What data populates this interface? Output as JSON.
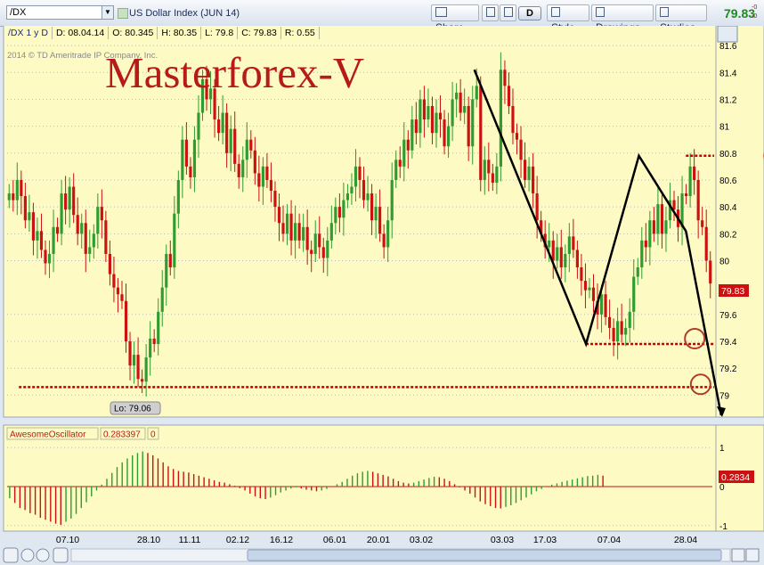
{
  "toolbar": {
    "symbol": "/DX",
    "instrument_name": "US Dollar Index (JUN 14)",
    "buttons": {
      "share": "Share",
      "d": "D",
      "style": "Style",
      "drawings": "Drawings",
      "studies": "Studies"
    },
    "last_price": "79.83",
    "change_top": "-0",
    "change_bottom": "-0"
  },
  "info_bar": {
    "symbol_period": "/DX 1 y D",
    "date": "D: 08.04.14",
    "open": "O: 80.345",
    "high": "H: 80.35",
    "low": "L: 79.8",
    "close": "C: 79.83",
    "range": "R: 0.55"
  },
  "copyright": "2014 © TD Ameritrade IP Company, Inc.",
  "watermark": "Masterforex-V",
  "colors": {
    "bg": "#fdfbc3",
    "up": "#2e9c2e",
    "down": "#cc1111",
    "grid": "#b9b9b9",
    "pattern": "#000000",
    "level": "#c00000"
  },
  "chart_data": [
    {
      "type": "candlestick",
      "title": "US Dollar Index (JUN 14)",
      "period": "1 year, daily",
      "ylim": [
        78.85,
        81.7
      ],
      "y_ticks": [
        "81.6",
        "81.4",
        "81.2",
        "81",
        "80.8",
        "80.6",
        "80.4",
        "80.2",
        "80",
        "79.6",
        "79.4",
        "79.2",
        "79"
      ],
      "x_ticks": [
        "07.10",
        "28.10",
        "11.11",
        "02.12",
        "16.12",
        "06.01",
        "20.01",
        "03.02",
        "03.03",
        "17.03",
        "07.04",
        "28.04"
      ],
      "last_price_label": "79.83",
      "low_label": "Lo: 79.06",
      "series_close": [
        80.5,
        80.45,
        80.6,
        80.48,
        80.3,
        80.36,
        80.15,
        80.22,
        80.08,
        79.98,
        80.05,
        80.25,
        80.2,
        80.5,
        80.38,
        80.55,
        80.34,
        80.2,
        80.28,
        80.05,
        80.1,
        80.2,
        80.4,
        80.3,
        80.05,
        79.9,
        79.8,
        79.75,
        79.7,
        79.4,
        79.22,
        79.3,
        79.12,
        79.1,
        79.28,
        79.42,
        79.38,
        79.62,
        79.8,
        80.05,
        79.95,
        80.35,
        80.6,
        80.9,
        80.7,
        80.62,
        80.9,
        81.1,
        81.35,
        81.2,
        81.28,
        81.05,
        80.95,
        81.1,
        80.8,
        80.98,
        80.72,
        80.62,
        80.75,
        80.9,
        80.82,
        80.65,
        80.55,
        80.7,
        80.6,
        80.52,
        80.4,
        80.28,
        80.2,
        80.35,
        80.15,
        80.28,
        80.15,
        80.25,
        80.08,
        80.05,
        80.2,
        80.1,
        80.02,
        80.15,
        80.28,
        80.4,
        80.32,
        80.45,
        80.5,
        80.55,
        80.7,
        80.6,
        80.45,
        80.5,
        80.3,
        80.4,
        80.2,
        80.1,
        80.3,
        80.6,
        80.75,
        80.7,
        80.9,
        80.82,
        81.05,
        80.95,
        81.2,
        81.05,
        81.15,
        80.95,
        81.1,
        81.05,
        80.85,
        81.0,
        81.2,
        81.25,
        81.1,
        81.15,
        80.85,
        81.2,
        81.3,
        80.6,
        80.75,
        80.65,
        80.58,
        80.7,
        81.42,
        81.3,
        81.15,
        80.95,
        80.9,
        80.75,
        80.6,
        80.7,
        80.5,
        80.3,
        80.2,
        80.1,
        80.15,
        80.0,
        80.1,
        79.95,
        80.05,
        80.18,
        80.08,
        79.95,
        79.85,
        79.78,
        79.8,
        79.7,
        79.6,
        79.75,
        79.58,
        79.5,
        79.4,
        79.55,
        79.45,
        79.5,
        79.62,
        79.88,
        79.95,
        80.15,
        80.1,
        80.3,
        80.2,
        80.42,
        80.2,
        80.3,
        80.45,
        80.38,
        80.25,
        80.5,
        80.48,
        80.7,
        80.6,
        80.3,
        80.25,
        80.0,
        79.83
      ],
      "pattern_polyline": [
        [
          0.795,
          81.42
        ],
        [
          0.985,
          79.38
        ],
        [
          1.075,
          80.78
        ],
        [
          1.155,
          80.22
        ],
        [
          1.215,
          78.85
        ]
      ],
      "forecast_polyline": [
        [
          1.325,
          80.68
        ],
        [
          1.345,
          80.95
        ],
        [
          1.395,
          80.78
        ],
        [
          1.455,
          81.6
        ]
      ],
      "levels": [
        {
          "x_from": 1.155,
          "x_to": 1.5,
          "y": 80.78
        },
        {
          "x_from": 0.985,
          "x_to": 1.235,
          "y": 79.38
        },
        {
          "x_from": 0.02,
          "x_to": 1.265,
          "y": 79.06
        }
      ],
      "circles": [
        [
          1.305,
          80.78
        ],
        [
          1.17,
          79.42
        ],
        [
          1.18,
          79.08
        ]
      ]
    },
    {
      "type": "bar",
      "title": "AwesomeOscillator",
      "value_label": "0.283397",
      "param": "0",
      "ylim": [
        -1.05,
        1.05
      ],
      "y_ticks": [
        "1",
        "0",
        "-1"
      ],
      "last_value_label": "0.2834",
      "values": [
        -0.3,
        -0.42,
        -0.55,
        -0.6,
        -0.68,
        -0.72,
        -0.8,
        -0.85,
        -0.9,
        -0.95,
        -0.98,
        -0.9,
        -0.82,
        -0.7,
        -0.55,
        -0.4,
        -0.25,
        -0.1,
        0.05,
        0.2,
        0.35,
        0.5,
        0.62,
        0.72,
        0.8,
        0.86,
        0.9,
        0.86,
        0.8,
        0.72,
        0.62,
        0.52,
        0.45,
        0.4,
        0.38,
        0.36,
        0.32,
        0.28,
        0.24,
        0.2,
        0.16,
        0.12,
        0.1,
        0.06,
        0.02,
        -0.04,
        -0.1,
        -0.18,
        -0.25,
        -0.3,
        -0.32,
        -0.28,
        -0.22,
        -0.15,
        -0.1,
        -0.05,
        -0.02,
        -0.05,
        -0.08,
        -0.1,
        -0.12,
        -0.1,
        -0.06,
        0.0,
        0.06,
        0.12,
        0.2,
        0.28,
        0.34,
        0.38,
        0.4,
        0.38,
        0.34,
        0.3,
        0.26,
        0.2,
        0.14,
        0.1,
        0.08,
        0.1,
        0.14,
        0.18,
        0.22,
        0.25,
        0.24,
        0.2,
        0.14,
        0.06,
        -0.02,
        -0.1,
        -0.18,
        -0.28,
        -0.38,
        -0.45,
        -0.5,
        -0.55,
        -0.56,
        -0.52,
        -0.48,
        -0.42,
        -0.35,
        -0.28,
        -0.2,
        -0.12,
        -0.06,
        0.0,
        0.05,
        0.08,
        0.12,
        0.15,
        0.18,
        0.21,
        0.24,
        0.27,
        0.28,
        0.3,
        0.28
      ]
    }
  ]
}
